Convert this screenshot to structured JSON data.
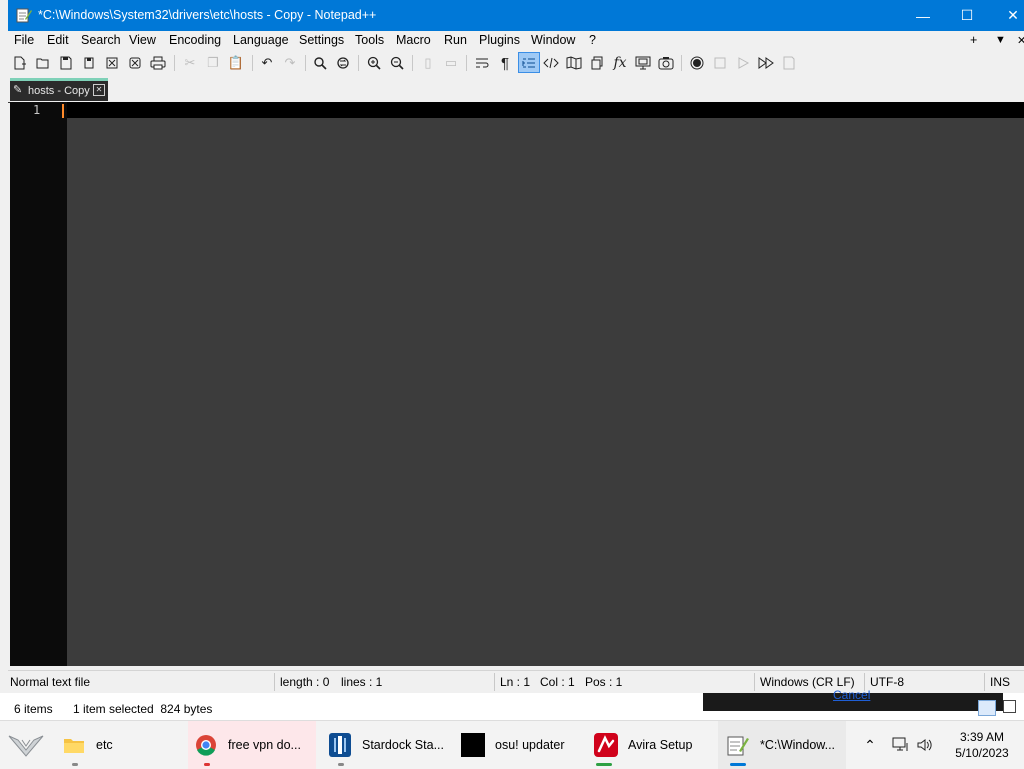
{
  "window": {
    "title": "*C:\\Windows\\System32\\drivers\\etc\\hosts - Copy - Notepad++",
    "minimize_glyph": "—",
    "maximize_glyph": "☐",
    "close_glyph": "✕"
  },
  "menu": {
    "items": [
      "File",
      "Edit",
      "Search",
      "View",
      "Encoding",
      "Language",
      "Settings",
      "Tools",
      "Macro",
      "Run",
      "Plugins",
      "Window",
      "?"
    ],
    "right": [
      "+",
      "▼",
      "✕"
    ]
  },
  "toolbar": {
    "icons": [
      "new-file-icon",
      "open-file-icon",
      "save-icon",
      "save-all-icon",
      "close-icon",
      "close-all-icon",
      "print-icon",
      "cut-icon",
      "copy-icon",
      "paste-icon",
      "undo-icon",
      "redo-icon",
      "find-icon",
      "replace-icon",
      "zoom-in-icon",
      "zoom-out-icon",
      "sync-vertical-icon",
      "sync-horizontal-icon",
      "word-wrap-icon",
      "show-all-chars-icon",
      "indent-guide-icon",
      "xml-tag-icon",
      "document-map-icon",
      "document-list-icon",
      "function-list-icon",
      "monitoring-icon",
      "folder-as-workspace-icon",
      "record-macro-icon",
      "stop-macro-icon",
      "play-macro-icon",
      "run-macro-multiple-icon",
      "save-macro-icon"
    ]
  },
  "tab": {
    "label": "hosts - Copy",
    "close_glyph": "✕"
  },
  "editor": {
    "line_numbers": [
      "1"
    ],
    "content": ""
  },
  "status": {
    "file_type": "Normal text file",
    "length": "length : 0",
    "lines": "lines : 1",
    "ln": "Ln : 1",
    "col": "Col : 1",
    "pos": "Pos : 1",
    "eol": "Windows (CR LF)",
    "encoding": "UTF-8",
    "mode": "INS"
  },
  "explorer": {
    "items": "6 items",
    "selected": "1 item selected  824 bytes",
    "cancel": "Cancel"
  },
  "taskbar": {
    "tasks": [
      {
        "label": "etc"
      },
      {
        "label": "free vpn do..."
      },
      {
        "label": "Stardock Sta..."
      },
      {
        "label": "osu! updater"
      },
      {
        "label": "Avira Setup"
      },
      {
        "label": "*C:\\Window..."
      }
    ],
    "time": "3:39 AM",
    "date": "5/10/2023"
  },
  "colors": {
    "titlebar": "#0078d7",
    "editor_bg": "#3c3c3c",
    "gutter_bg": "#0b0b0b",
    "caret": "#ff8a2a",
    "tab_accent": "#7fd1b8"
  }
}
